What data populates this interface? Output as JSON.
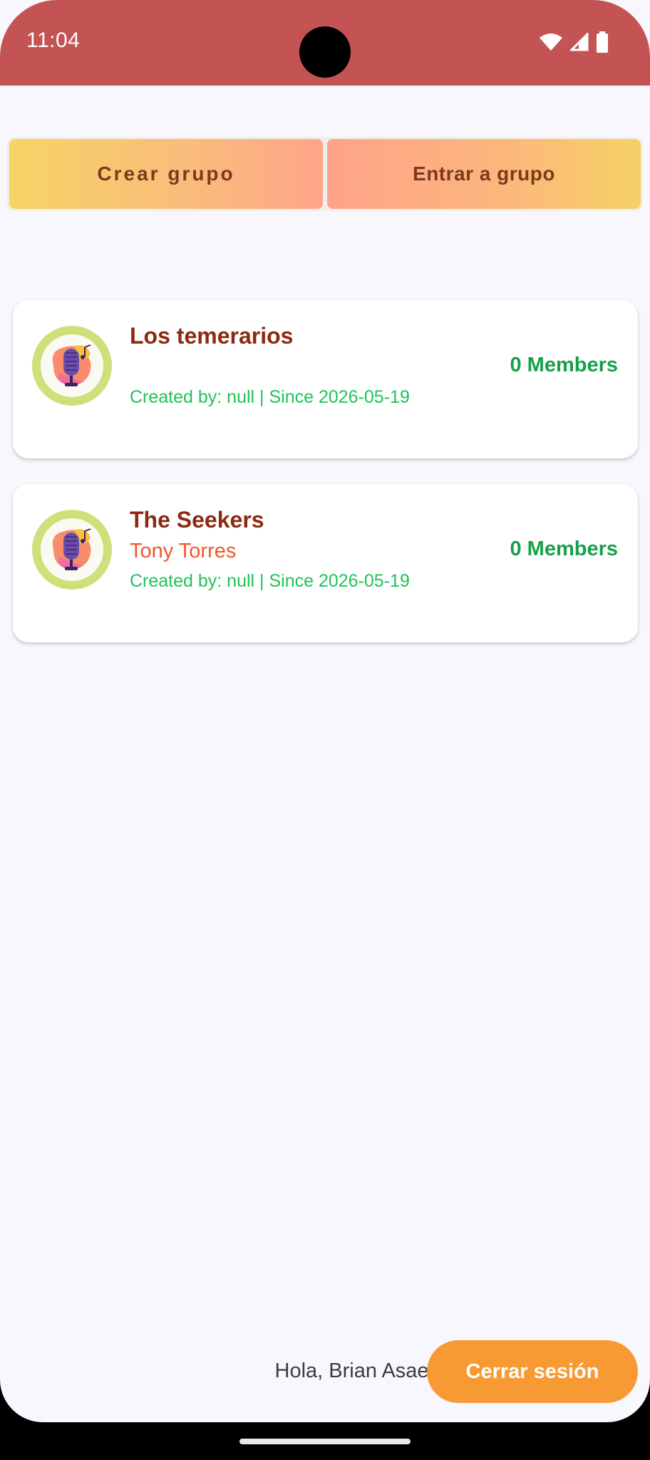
{
  "status_bar": {
    "time": "11:04",
    "icons": [
      "wifi-icon",
      "cellular-signal-icon",
      "battery-icon"
    ],
    "color": "#c45354"
  },
  "actions": {
    "create_group_label": "Crear grupo",
    "join_group_label": "Entrar a grupo"
  },
  "groups": [
    {
      "name": "Los temerarios",
      "subtitle": "",
      "meta": "Created by: null | Since 2026-05-19",
      "members": "0 Members",
      "avatar_icon": "microphone-icon"
    },
    {
      "name": "The Seekers",
      "subtitle": "Tony Torres",
      "meta": "Created by: null | Since 2026-05-19",
      "members": "0 Members",
      "avatar_icon": "microphone-icon"
    }
  ],
  "footer": {
    "greeting": "Hola, Brian Asael",
    "logout_label": "Cerrar sesión"
  },
  "colors": {
    "accent_orange": "#f89a34",
    "title_brown": "#8b2a10",
    "subtitle_orange": "#f2572a",
    "meta_green": "#1ec359",
    "members_green": "#16a04a"
  }
}
